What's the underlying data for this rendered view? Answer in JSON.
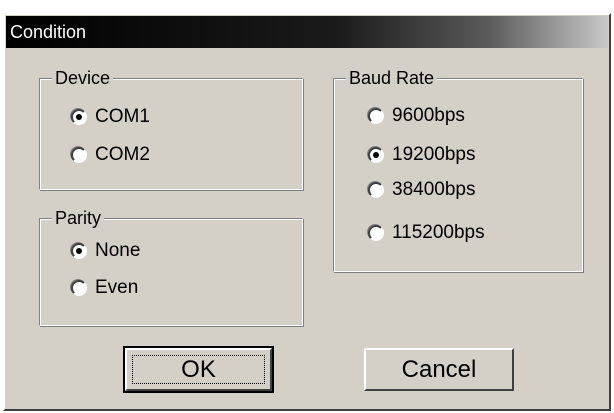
{
  "dialog": {
    "title": "Condition"
  },
  "device": {
    "legend": "Device",
    "options": [
      {
        "label": "COM1",
        "selected": true
      },
      {
        "label": "COM2",
        "selected": false
      }
    ]
  },
  "parity": {
    "legend": "Parity",
    "options": [
      {
        "label": "None",
        "selected": true
      },
      {
        "label": "Even",
        "selected": false
      }
    ]
  },
  "baud": {
    "legend": "Baud Rate",
    "options": [
      {
        "label": "9600bps",
        "selected": false
      },
      {
        "label": "19200bps",
        "selected": true
      },
      {
        "label": "38400bps",
        "selected": false
      },
      {
        "label": "115200bps",
        "selected": false
      }
    ]
  },
  "buttons": {
    "ok": "OK",
    "cancel": "Cancel"
  }
}
